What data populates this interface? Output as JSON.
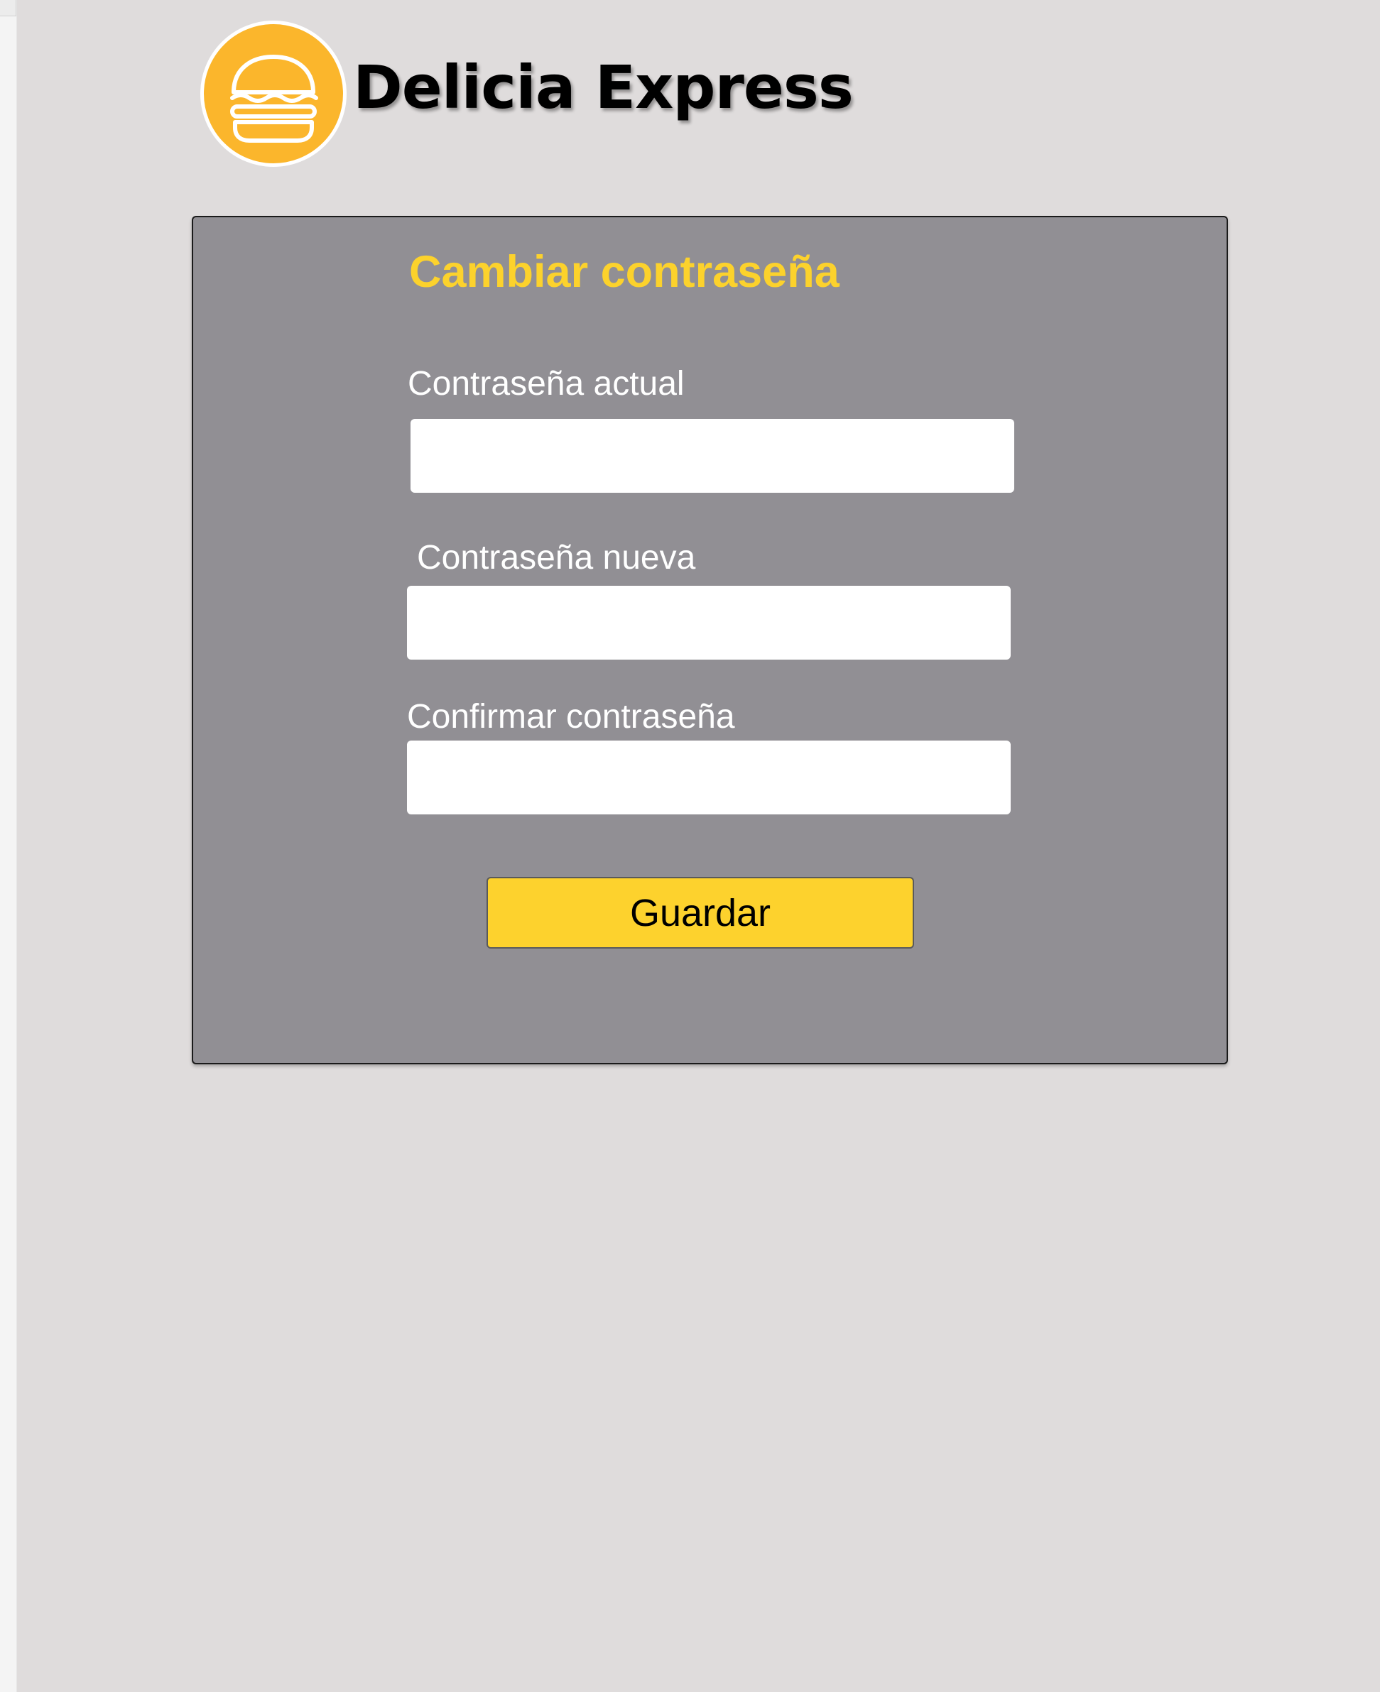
{
  "brand": {
    "name": "Delicia Express",
    "logo_icon": "burger-icon",
    "logo_color": "#fbb62c"
  },
  "form": {
    "title": "Cambiar contraseña",
    "title_color": "#fcd22c",
    "panel_color": "#918f94",
    "current_password": {
      "label": "Contraseña actual",
      "value": ""
    },
    "new_password": {
      "label": "Contraseña nueva",
      "value": ""
    },
    "confirm_password": {
      "label": "Confirmar contraseña",
      "value": ""
    },
    "save_label": "Guardar",
    "save_color": "#fdd22d"
  }
}
